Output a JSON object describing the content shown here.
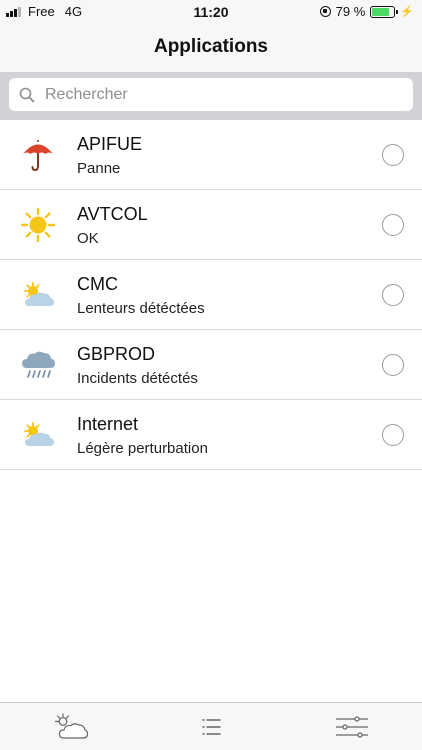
{
  "status_bar": {
    "carrier": "Free",
    "network": "4G",
    "time": "11:20",
    "battery": "79 %",
    "battery_level": 0.79,
    "battery_color": "#4cd964"
  },
  "nav": {
    "title": "Applications"
  },
  "search": {
    "placeholder": "Rechercher",
    "value": ""
  },
  "applications": [
    {
      "name": "APIFUE",
      "status": "Panne",
      "icon": "umbrella-icon",
      "color": "#d9442a"
    },
    {
      "name": "AVTCOL",
      "status": "OK",
      "icon": "sun-icon",
      "color": "#f5c518"
    },
    {
      "name": "CMC",
      "status": "Lenteurs détéctées",
      "icon": "partly-cloudy-icon",
      "color": "#b9d3e6"
    },
    {
      "name": "GBPROD",
      "status": "Incidents détéctés",
      "icon": "rain-cloud-icon",
      "color": "#8fa7bd"
    },
    {
      "name": "Internet",
      "status": "Légère perturbation",
      "icon": "partly-cloudy-icon",
      "color": "#b9d3e6"
    }
  ],
  "tabs": [
    {
      "icon": "weather-tab-icon"
    },
    {
      "icon": "list-tab-icon"
    },
    {
      "icon": "filters-tab-icon"
    }
  ]
}
